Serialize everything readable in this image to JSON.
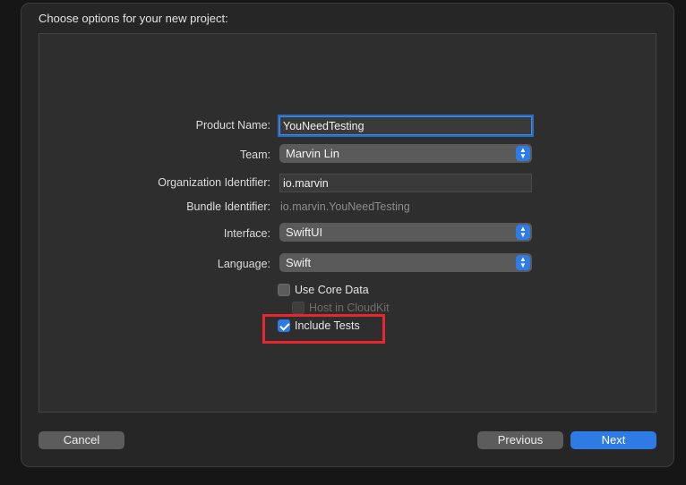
{
  "dialog": {
    "title": "Choose options for your new project:"
  },
  "form": {
    "product_name": {
      "label": "Product Name:",
      "value": "YouNeedTesting"
    },
    "team": {
      "label": "Team:",
      "value": "Marvin Lin"
    },
    "organization_identifier": {
      "label": "Organization Identifier:",
      "value": "io.marvin"
    },
    "bundle_identifier": {
      "label": "Bundle Identifier:",
      "value": "io.marvin.YouNeedTesting"
    },
    "interface": {
      "label": "Interface:",
      "value": "SwiftUI"
    },
    "language": {
      "label": "Language:",
      "value": "Swift"
    },
    "use_core_data": {
      "label": "Use Core Data",
      "checked": false
    },
    "host_in_cloudkit": {
      "label": "Host in CloudKit",
      "checked": false,
      "enabled": false
    },
    "include_tests": {
      "label": "Include Tests",
      "checked": true
    }
  },
  "buttons": {
    "cancel": "Cancel",
    "previous": "Previous",
    "next": "Next"
  },
  "colors": {
    "accent": "#2f7be6",
    "highlight": "#e8262c",
    "background": "#262626"
  },
  "icons": {
    "popup_stepper": "chevron-up-down-icon",
    "checkmark": "checkmark-icon"
  }
}
